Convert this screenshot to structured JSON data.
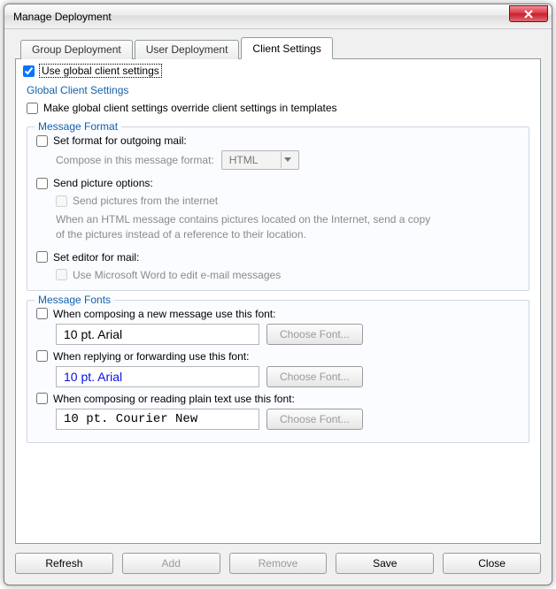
{
  "window": {
    "title": "Manage Deployment"
  },
  "tabs": {
    "group": "Group Deployment",
    "user": "User Deployment",
    "client": "Client Settings"
  },
  "useGlobal": "Use global client settings",
  "sectionTitle": "Global Client Settings",
  "overrideLabel": "Make global client settings override client settings in templates",
  "messageFormat": {
    "legend": "Message Format",
    "setFormat": "Set format for outgoing mail:",
    "composeIn": "Compose in this message format:",
    "formatValue": "HTML",
    "sendPictureOptions": "Send picture options:",
    "sendPicturesInternet": "Send pictures from the internet",
    "sendPicturesHelp": "When an HTML message contains pictures located on the Internet, send a copy of the pictures instead of a reference to their location.",
    "setEditor": "Set editor for mail:",
    "useWord": "Use Microsoft Word to edit e-mail messages"
  },
  "messageFonts": {
    "legend": "Message Fonts",
    "composeLabel": "When composing a new message use this font:",
    "composeFont": "10 pt. Arial",
    "replyLabel": "When replying or forwarding use this font:",
    "replyFont": "10 pt. Arial",
    "plainLabel": "When composing or reading plain text use this font:",
    "plainFont": "10 pt. Courier New",
    "chooseFont": "Choose Font..."
  },
  "buttons": {
    "refresh": "Refresh",
    "add": "Add",
    "remove": "Remove",
    "save": "Save",
    "close": "Close"
  }
}
